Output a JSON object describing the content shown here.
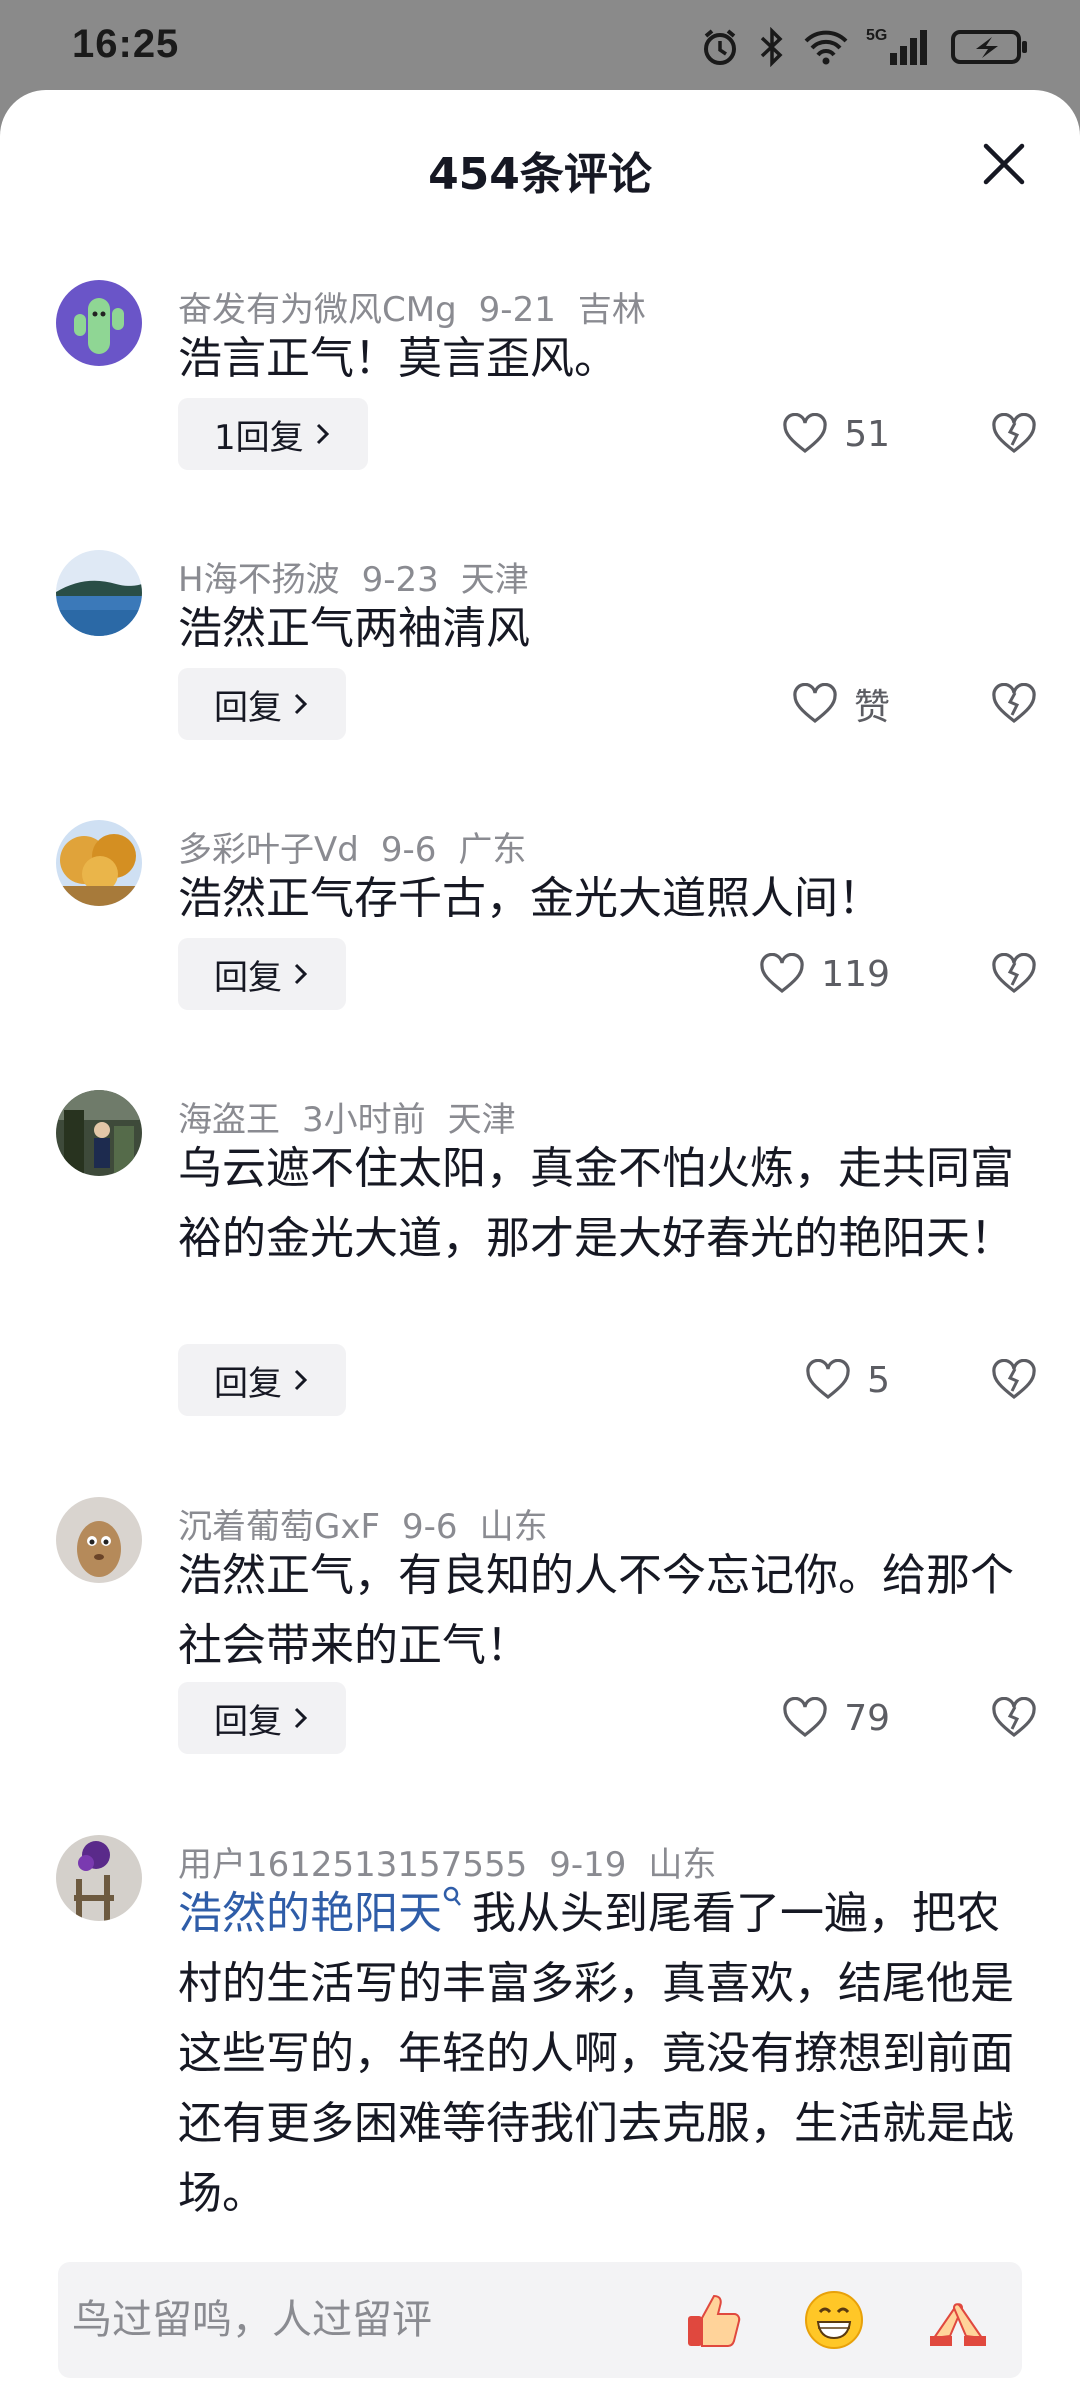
{
  "status": {
    "time": "16:25",
    "network": "5G"
  },
  "header": {
    "title": "454条评论"
  },
  "comments": [
    {
      "user": "奋发有为微风CMg",
      "date": "9-21",
      "location": "吉林",
      "text": "浩言正气！莫言歪风。",
      "reply": "1回复",
      "likes": "51"
    },
    {
      "user": "H海不扬波",
      "date": "9-23",
      "location": "天津",
      "text": "浩然正气两袖清风",
      "reply": "回复",
      "likes": "赞"
    },
    {
      "user": "多彩叶子Vd",
      "date": "9-6",
      "location": "广东",
      "text": "浩然正气存千古，金光大道照人间！",
      "reply": "回复",
      "likes": "119"
    },
    {
      "user": "海盗王",
      "date": "3小时前",
      "location": "天津",
      "text": "乌云遮不住太阳，真金不怕火炼，走共同富裕的金光大道，那才是大好春光的艳阳天！",
      "reply": "回复",
      "likes": "5"
    },
    {
      "user": "沉着葡萄GxF",
      "date": "9-6",
      "location": "山东",
      "text": "浩然正气，有良知的人不今忘记你。给那个社会带来的正气！",
      "reply": "回复",
      "likes": "79"
    },
    {
      "user": "用户1612513157555",
      "date": "9-19",
      "location": "山东",
      "highlight": "浩然的艳阳天",
      "text": "我从头到尾看了一遍，把农村的生活写的丰富多彩，真喜欢，结尾他是这些写的，年轻的人啊，竟没有撩想到前面还有更多困难等待我们去克服，生活就是战场。"
    }
  ],
  "bottom": {
    "placeholder": "鸟过留鸣，人过留评",
    "emoji": [
      "thumbs-up-icon",
      "grin-icon",
      "clap-icon"
    ]
  }
}
